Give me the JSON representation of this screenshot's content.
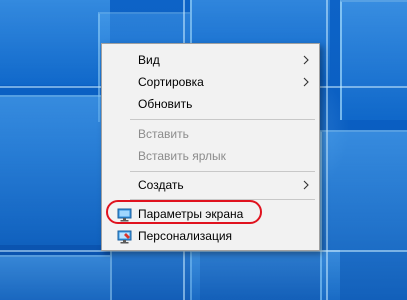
{
  "context_menu": {
    "items": [
      {
        "label": "Вид",
        "submenu": true,
        "enabled": true
      },
      {
        "label": "Сортировка",
        "submenu": true,
        "enabled": true
      },
      {
        "label": "Обновить",
        "submenu": false,
        "enabled": true
      },
      {
        "label": "Вставить",
        "submenu": false,
        "enabled": false
      },
      {
        "label": "Вставить ярлык",
        "submenu": false,
        "enabled": false
      },
      {
        "label": "Создать",
        "submenu": true,
        "enabled": true
      },
      {
        "label": "Параметры экрана",
        "submenu": false,
        "enabled": true,
        "icon": "display-settings-icon",
        "highlighted": true
      },
      {
        "label": "Персонализация",
        "submenu": false,
        "enabled": true,
        "icon": "personalization-icon"
      }
    ]
  },
  "colors": {
    "desktop_blue": "#0a5fbf",
    "menu_background": "#f2f2f2",
    "disabled_text": "#8c8c8c",
    "highlight_ring": "#e0121e"
  }
}
